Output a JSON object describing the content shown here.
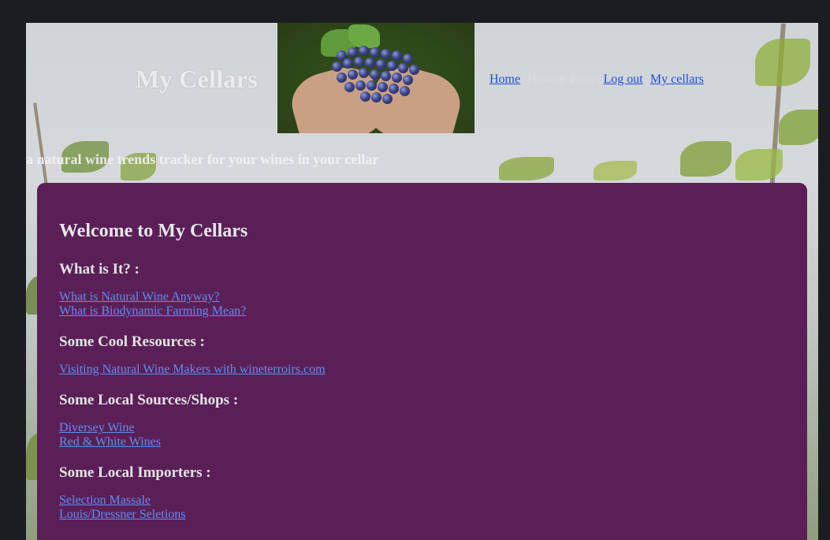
{
  "header": {
    "title": "My Cellars",
    "tagline": "a natural wine trends tracker for your wines in your cellar"
  },
  "nav": {
    "home": "Home",
    "greeting": "Howdy, Peter",
    "logout": "Log out",
    "my_cellars": "My cellars",
    "separator": "|"
  },
  "content": {
    "heading": "Welcome to My Cellars",
    "sections": [
      {
        "title": "What is It? :",
        "links": [
          "What is Natural Wine Anyway?",
          "What is Biodynamic Farming Mean?"
        ]
      },
      {
        "title": "Some Cool Resources :",
        "links": [
          "Visiting Natural Wine Makers with wineterroirs.com"
        ]
      },
      {
        "title": "Some Local Sources/Shops :",
        "links": [
          "Diversey Wine",
          "Red & White Wines"
        ]
      },
      {
        "title": "Some Local Importers :",
        "links": [
          "Selection Massale",
          "Louis/Dressner Seletions"
        ]
      }
    ]
  },
  "colors": {
    "page_background": "#1c1d20",
    "panel": "#5b1f58",
    "nav_link": "#1a4fd6",
    "content_link": "#5f8ef0"
  },
  "icons": {
    "hero": "grapes-in-hands-photo"
  }
}
